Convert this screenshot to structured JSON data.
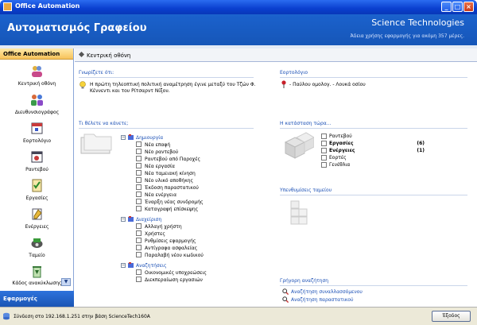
{
  "window": {
    "title": "Office Automation"
  },
  "header": {
    "app_title": "Αυτοματισμός Γραφείου",
    "company": "Science Technologies",
    "license": "Άδεια χρήσης εφαρμογής για ακόμη 357 μέρες."
  },
  "sidebar": {
    "header": "Office Automation",
    "items": [
      {
        "label": "Κεντρική οθόνη",
        "icon": "user-group-icon"
      },
      {
        "label": "Διευθυνσιογράφος",
        "icon": "contacts-icon"
      },
      {
        "label": "Εορτολόγιο",
        "icon": "calendar-icon"
      },
      {
        "label": "Ραντεβού",
        "icon": "appointment-icon"
      },
      {
        "label": "Εργασίες",
        "icon": "tasks-icon"
      },
      {
        "label": "Ενέργειες",
        "icon": "actions-icon"
      },
      {
        "label": "Ταμείο",
        "icon": "cashbox-icon"
      },
      {
        "label": "Κάδος ανακύκλωσης",
        "icon": "recycle-bin-icon"
      }
    ],
    "footer": "Εφαρμογές"
  },
  "breadcrumb": "Κεντρική οθόνη",
  "did_you_know": {
    "title": "Γνωρίζετε ότι:",
    "text_line1": "Η πρώτη τηλεοπτική πολιτική αναμέτρηση έγινε μεταξύ του Τζών Φ.",
    "text_line2": "Κέννεντι και του Ρίτσαρντ Νίξον."
  },
  "name_days": {
    "title": "Εορτολόγιο",
    "text": "- Παύλου ομολογ. - Λουκά οσίου"
  },
  "what_to_do": {
    "title": "Τι θέλετε να κάνετε;",
    "groups": [
      {
        "label": "Δημιουργία",
        "items": [
          "Νέα επαφή",
          "Νέο ραντεβού",
          "Ραντεβού από Παροχές",
          "Νέα εργασία",
          "Νέα ταμειακή κίνηση",
          "Νέο υλικό αποθήκης",
          "Έκδοση παραστατικού",
          "Νέα ενέργεια",
          "Έναρξη νέας συνδρομής",
          "Καταγραφή επίσκεψης"
        ]
      },
      {
        "label": "Διαχείριση",
        "items": [
          "Αλλαγή χρήστη",
          "Χρήστες",
          "Ρυθμίσεις εφαρμογής",
          "Αντίγραφα ασφαλείας",
          "Παραλαβή νέου κωδικού"
        ]
      },
      {
        "label": "Αναζητήσεις",
        "items": [
          "Οικονομικές υποχρεώσεις",
          "Διεκπεραίωση εργασιών"
        ]
      }
    ]
  },
  "status": {
    "title": "Η κατάσταση τώρα...",
    "rows": [
      {
        "label": "Ραντεβού",
        "count": "",
        "bold": false
      },
      {
        "label": "Εργασίες",
        "count": "(6)",
        "bold": true
      },
      {
        "label": "Ενέργειες",
        "count": "(1)",
        "bold": true
      },
      {
        "label": "Εορτές",
        "count": "",
        "bold": false
      },
      {
        "label": "Γενέθλια",
        "count": "",
        "bold": false
      }
    ]
  },
  "reminders": {
    "title": "Υπενθυμίσεις ταμείου"
  },
  "quick_search": {
    "title": "Γρήγορη αναζήτηση",
    "links": [
      "Αναζήτηση συναλλασσόμενου",
      "Αναζήτηση παραστατικού"
    ]
  },
  "statusbar": {
    "text": "Σύνδεση στο 192.168.1.251 στην βάση ScienceTech160A",
    "exit": "Έξοδος"
  }
}
